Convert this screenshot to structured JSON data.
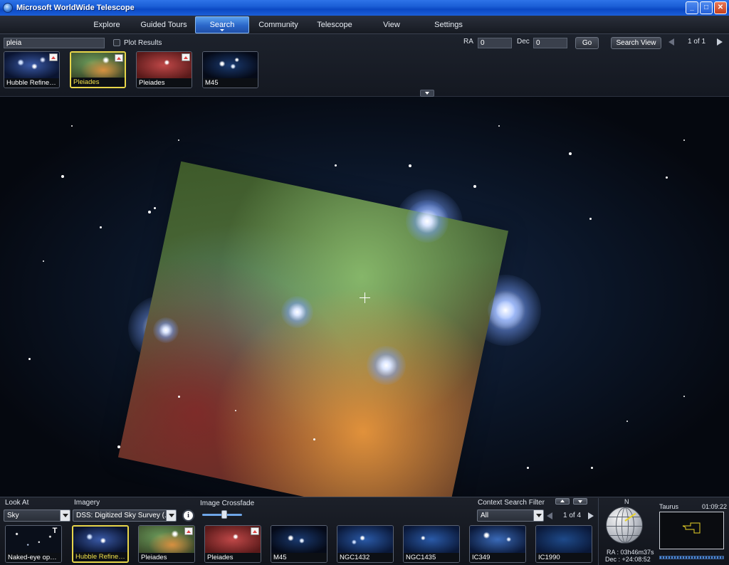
{
  "window": {
    "title": "Microsoft WorldWide Telescope"
  },
  "menu": {
    "items": [
      {
        "label": "Explore",
        "active": false
      },
      {
        "label": "Guided Tours",
        "active": false
      },
      {
        "label": "Search",
        "active": true
      },
      {
        "label": "Community",
        "active": false
      },
      {
        "label": "Telescope",
        "active": false
      },
      {
        "label": "View",
        "active": false
      },
      {
        "label": "Settings",
        "active": false
      }
    ]
  },
  "search": {
    "query": "pleia",
    "plot_results_label": "Plot Results",
    "ra_label": "RA",
    "ra_value": "0",
    "dec_label": "Dec",
    "dec_value": "0",
    "go_label": "Go",
    "search_view_label": "Search View",
    "page_indicator": "1 of 1",
    "results": [
      {
        "label": "Hubble Refines D...",
        "selected": false,
        "has_badge": true
      },
      {
        "label": "Pleiades",
        "selected": true,
        "has_badge": true
      },
      {
        "label": "Pleiades",
        "selected": false,
        "has_badge": true
      },
      {
        "label": "M45",
        "selected": false,
        "has_badge": false
      }
    ]
  },
  "bottom": {
    "look_at_label": "Look At",
    "look_at_value": "Sky",
    "imagery_label": "Imagery",
    "imagery_value": "DSS: Digitized Sky Survey (...",
    "crossfade_label": "Image Crossfade",
    "crossfade_level": 0.55,
    "context_filter_label": "Context Search Filter",
    "context_filter_value": "All",
    "page_indicator": "1 of 4",
    "thumbnails": [
      {
        "label": "Naked-eye open...",
        "selected": false,
        "badge": "T"
      },
      {
        "label": "Hubble Refines D...",
        "selected": true,
        "badge": ""
      },
      {
        "label": "Pleiades",
        "selected": false,
        "badge": "img"
      },
      {
        "label": "Pleiades",
        "selected": false,
        "badge": "img"
      },
      {
        "label": "M45",
        "selected": false,
        "badge": ""
      },
      {
        "label": "NGC1432",
        "selected": false,
        "badge": ""
      },
      {
        "label": "NGC1435",
        "selected": false,
        "badge": ""
      },
      {
        "label": "IC349",
        "selected": false,
        "badge": ""
      },
      {
        "label": "IC1990",
        "selected": false,
        "badge": ""
      }
    ]
  },
  "status": {
    "north_label": "N",
    "ra_readout": "RA : 03h46m37s",
    "dec_readout": "Dec : +24:08:52",
    "constellation": "Taurus",
    "time": "01:09:22"
  },
  "colors": {
    "accent_selected": "#e8d64a",
    "menu_active": "#2a66c8",
    "titlebar": "#0b49c4"
  },
  "icons": {
    "app": "telescope-globe-icon",
    "minimize": "minimize-icon",
    "maximize": "maximize-icon",
    "close": "close-icon",
    "info": "info-icon",
    "prev": "chevron-left-icon",
    "next": "chevron-right-icon"
  }
}
